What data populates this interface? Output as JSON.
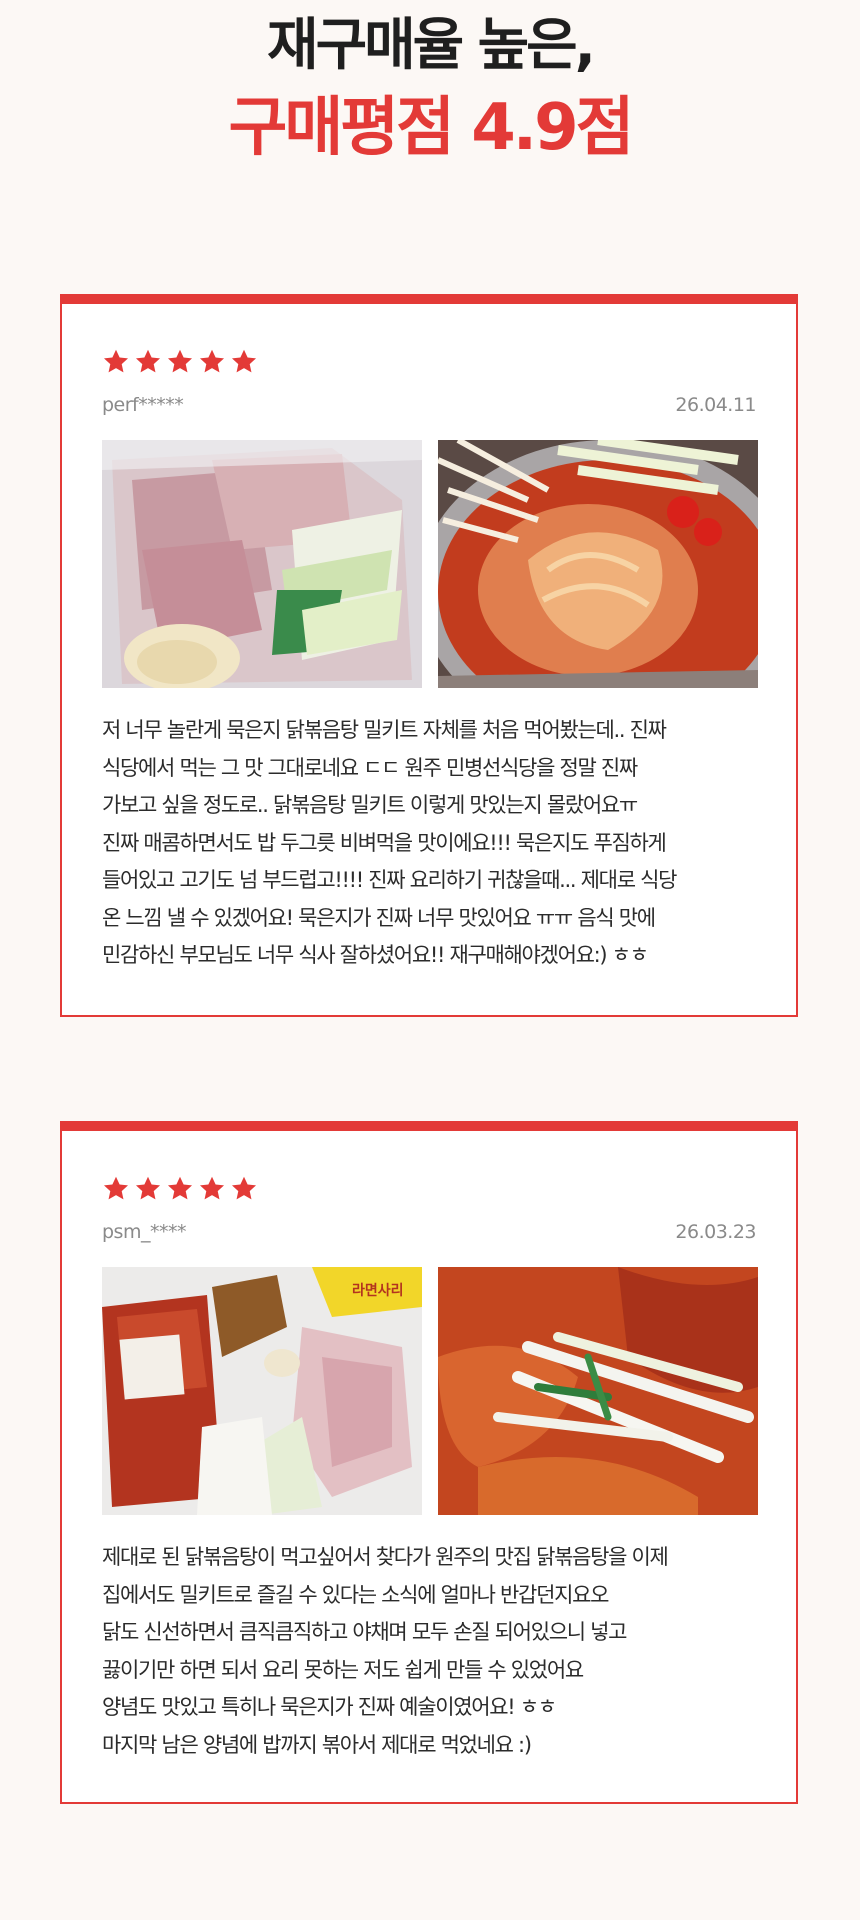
{
  "headline": {
    "line1": "재구매율 높은,",
    "line2": "구매평점 4.9점"
  },
  "colors": {
    "accent": "#e33a37",
    "background": "#fcf8f5"
  },
  "reviews": [
    {
      "rating": 5,
      "user": "perf*****",
      "date": "26.04.11",
      "photos": [
        "meal-kit-package-photo",
        "cooked-stew-pot-photo"
      ],
      "lines": [
        "저 너무 놀란게 묵은지 닭볶음탕 밀키트 자체를 처음 먹어봤는데.. 진짜",
        "식당에서 먹는 그 맛 그대로네요 ㄷㄷ 원주 민병선식당을 정말 진짜",
        "가보고 싶을 정도로.. 닭볶음탕 밀키트 이렇게 맛있는지 몰랐어요ㅠ",
        "진짜 매콤하면서도 밥 두그릇 비벼먹을 맛이에요!!! 묵은지도 푸짐하게",
        "들어있고 고기도 넘 부드럽고!!!! 진짜 요리하기 귀찮을때... 제대로 식당",
        "온 느낌 낼 수 있겠어요! 묵은지가 진짜 너무 맛있어요 ㅠㅠ 음식 맛에",
        "민감하신 부모님도 너무 식사 잘하셨어요!! 재구매해야겠어요:) ㅎㅎ"
      ]
    },
    {
      "rating": 5,
      "user": "psm_****",
      "date": "26.03.23",
      "photos": [
        "meal-kit-ingredients-photo",
        "stew-closeup-photo"
      ],
      "lines": [
        "제대로 된 닭볶음탕이 먹고싶어서 찾다가 원주의 맛집 닭볶음탕을 이제",
        "집에서도 밀키트로 즐길 수 있다는 소식에 얼마나 반갑던지요오",
        "닭도 신선하면서 큼직큼직하고 야채며 모두 손질 되어있으니 넣고",
        "끓이기만 하면 되서 요리 못하는 저도 쉽게 만들 수 있었어요",
        "양념도 맛있고 특히나 묵은지가 진짜 예술이였어요! ㅎㅎ",
        "마지막 남은 양념에 밥까지 볶아서 제대로 먹었네요 :)"
      ]
    }
  ],
  "photo_labels": {
    "p0": "",
    "p1": "",
    "p2": "라면사리",
    "p3": ""
  }
}
